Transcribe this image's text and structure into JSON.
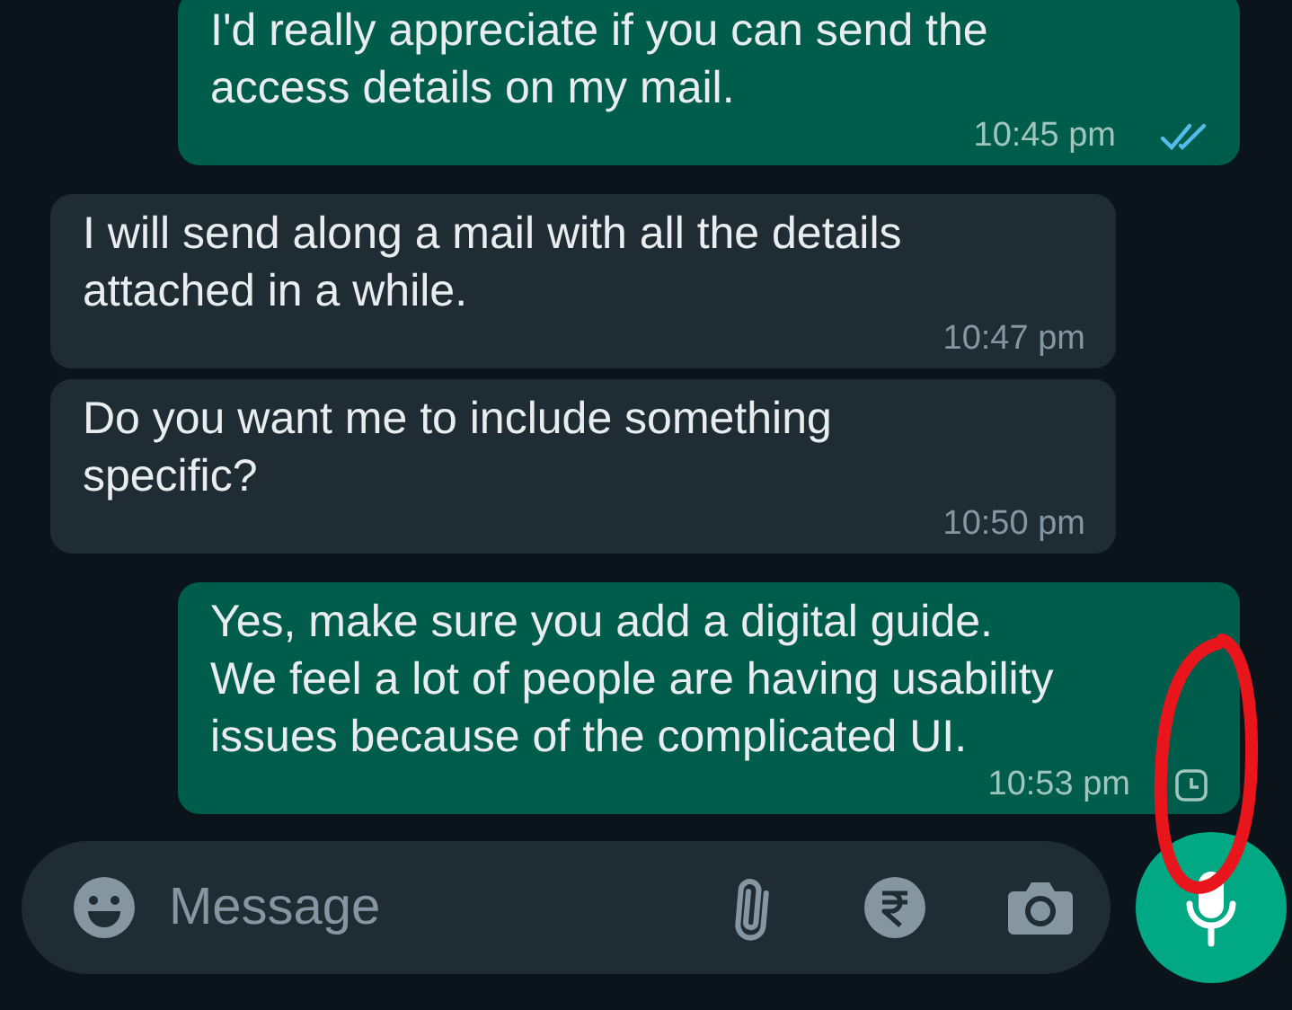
{
  "messages": [
    {
      "kind": "outgoing",
      "text": "I'd really appreciate if you can send the\naccess details on my mail.",
      "time": "10:45 pm",
      "read": true,
      "pending": false
    },
    {
      "kind": "incoming",
      "text": "I will send along a mail with all the details\nattached in a while.",
      "time": "10:47 pm"
    },
    {
      "kind": "incoming",
      "text": "Do you want me to include something\nspecific?",
      "time": "10:50 pm"
    },
    {
      "kind": "outgoing",
      "text": "Yes, make sure you add a digital guide.\nWe feel a lot of people are having usability\nissues because of the complicated UI.",
      "time": "10:53 pm",
      "read": false,
      "pending": true
    }
  ],
  "composer": {
    "placeholder": "Message"
  }
}
